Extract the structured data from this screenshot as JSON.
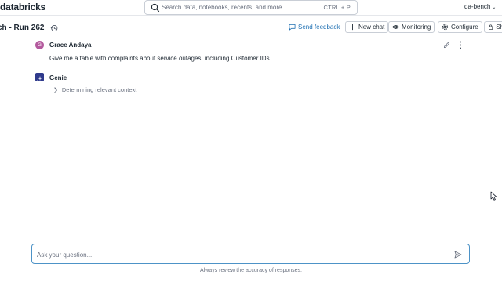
{
  "header": {
    "logo": "databricks",
    "search_placeholder": "Search data, notebooks, recents, and more...",
    "search_shortcut": "CTRL + P",
    "workspace": "da-bench"
  },
  "title_bar": {
    "title": "ch - Run 262",
    "send_feedback": "Send feedback",
    "new_chat": "New chat",
    "monitoring": "Monitoring",
    "configure": "Configure",
    "share": "Sh"
  },
  "conversation": {
    "user": {
      "avatar_initial": "G",
      "name": "Grace Andaya",
      "message": "Give me a table with complaints about service outages, including Customer IDs."
    },
    "assistant": {
      "name": "Genie",
      "status": "Determining relevant context"
    }
  },
  "composer": {
    "placeholder": "Ask your question...",
    "disclaimer": "Always review the accuracy of responses."
  },
  "colors": {
    "accent": "#2272b4",
    "user_avatar": "#b45a9e",
    "genie_avatar": "#2f3a8c",
    "input_border": "#4d93c7"
  }
}
